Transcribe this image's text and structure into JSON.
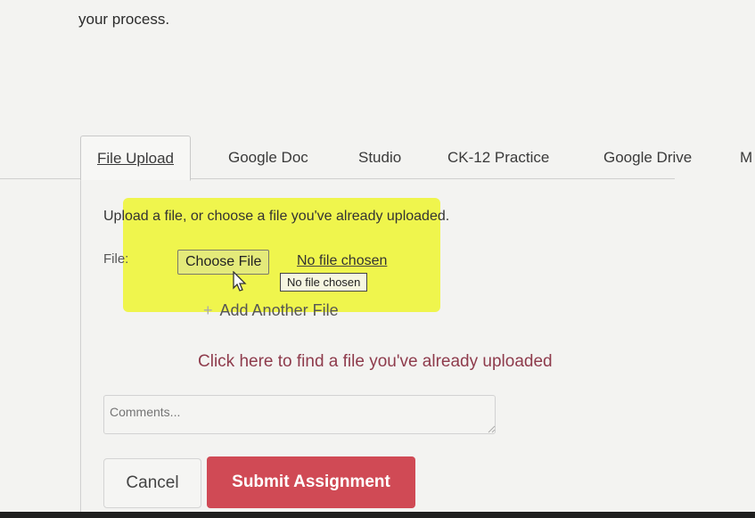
{
  "intro_text": "your process.",
  "tabs": [
    {
      "label": "File Upload"
    },
    {
      "label": "Google Doc"
    },
    {
      "label": "Studio"
    },
    {
      "label": "CK-12 Practice"
    },
    {
      "label": "Google Drive"
    },
    {
      "label": "M"
    }
  ],
  "upload": {
    "instructions": "Upload a file, or choose a file you've already uploaded.",
    "file_label": "File:",
    "choose_button": "Choose File",
    "no_file_text": "No file chosen",
    "tooltip": "No file chosen",
    "add_another": "Add Another File",
    "add_icon": "+",
    "find_link": "Click here to find a file you've already uploaded"
  },
  "comments": {
    "placeholder": "Comments..."
  },
  "actions": {
    "cancel": "Cancel",
    "submit": "Submit Assignment"
  },
  "colors": {
    "submit_bg": "#d04a55",
    "highlight": "#eff54d",
    "link": "#8e3b4c"
  }
}
